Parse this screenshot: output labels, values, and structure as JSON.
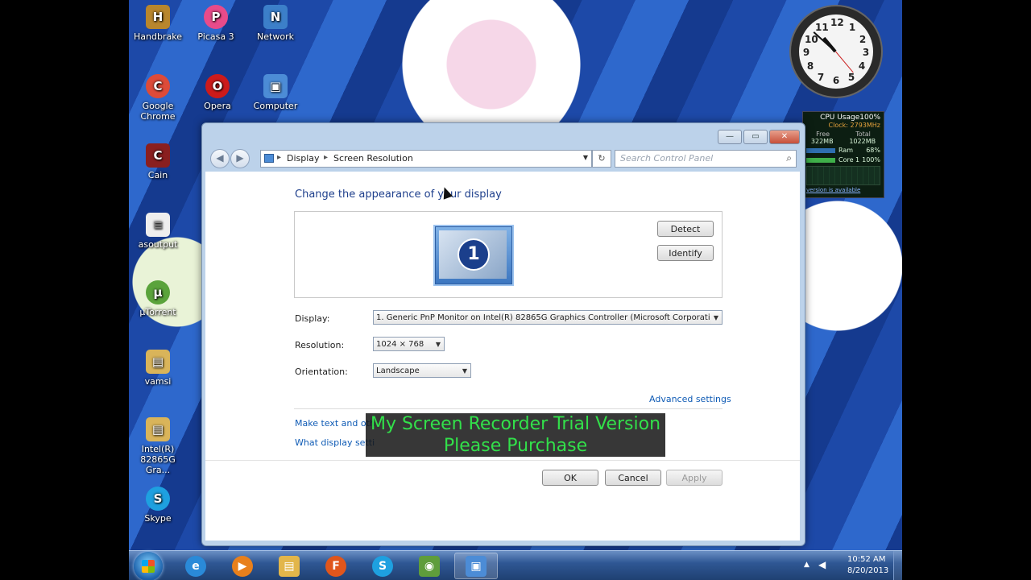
{
  "desktop": {
    "icons": [
      {
        "label": "Handbrake",
        "icon": "handbrake-icon",
        "color": "#b8862d",
        "glyph": "H"
      },
      {
        "label": "Picasa 3",
        "icon": "picasa-icon",
        "color": "#e84b8a",
        "glyph": "P"
      },
      {
        "label": "Network",
        "icon": "network-icon",
        "color": "#3c7fc9",
        "glyph": "N"
      },
      {
        "label": "Google Chrome",
        "icon": "chrome-icon",
        "color": "#dd4b39",
        "glyph": "C"
      },
      {
        "label": "Opera",
        "icon": "opera-icon",
        "color": "#cc1b1b",
        "glyph": "O"
      },
      {
        "label": "Computer",
        "icon": "computer-icon",
        "color": "#4c8cd6",
        "glyph": "▣"
      },
      {
        "label": "Cain",
        "icon": "cain-icon",
        "color": "#8a1f1f",
        "glyph": "C"
      },
      {
        "label": "asoutput",
        "icon": "document-icon",
        "color": "#eeeeee",
        "glyph": "≡"
      },
      {
        "label": "µTorrent",
        "icon": "utorrent-icon",
        "color": "#5aa33b",
        "glyph": "µ"
      },
      {
        "label": "vamsi",
        "icon": "folder-icon",
        "color": "#d9b45a",
        "glyph": "▤"
      },
      {
        "label": "Intel(R) 82865G Gra...",
        "icon": "intel-folder-icon",
        "color": "#d9b45a",
        "glyph": "▤"
      },
      {
        "label": "Skype",
        "icon": "skype-icon",
        "color": "#1ea0e0",
        "glyph": "S"
      }
    ]
  },
  "clock": {
    "numbers": [
      "12",
      "1",
      "2",
      "3",
      "4",
      "5",
      "6",
      "7",
      "8",
      "9",
      "10",
      "11"
    ]
  },
  "cpu_gadget": {
    "title": "CPU Usage100%",
    "clock": "Clock: 2793MHz",
    "ram_free": "322MB",
    "ram_total": "1022MB",
    "ram_label": "Ram",
    "ram_pct": "68%",
    "core_label": "Core 1",
    "core_pct": "100%",
    "free_label": "Free",
    "total_label": "Total",
    "footer": "version is available"
  },
  "window": {
    "controls": {
      "minimize": "—",
      "maximize": "▭",
      "close": "✕"
    },
    "back": "◀",
    "forward": "▶",
    "breadcrumb": {
      "root": "Display",
      "separator": "▸",
      "current": "Screen Resolution"
    },
    "refresh": "↻",
    "search_placeholder": "Search Control Panel",
    "heading": "Change the appearance of your display",
    "monitor_number": "1",
    "detect_label": "Detect",
    "identify_label": "Identify",
    "display_label": "Display:",
    "display_value": "1. Generic PnP Monitor on Intel(R) 82865G Graphics Controller (Microsoft Corporati",
    "resolution_label": "Resolution:",
    "resolution_value": "1024 × 768",
    "orientation_label": "Orientation:",
    "orientation_value": "Landscape",
    "advanced_link": "Advanced settings",
    "link1": "Make text and oth",
    "link2": "What display setti",
    "ok_label": "OK",
    "cancel_label": "Cancel",
    "apply_label": "Apply"
  },
  "watermark": {
    "line1": "My Screen Recorder Trial Version",
    "line2": "Please Purchase"
  },
  "taskbar": {
    "items": [
      {
        "icon": "internet-explorer-icon",
        "color": "#2a8ad8",
        "glyph": "e"
      },
      {
        "icon": "media-player-icon",
        "color": "#e8801c",
        "glyph": "▶"
      },
      {
        "icon": "explorer-folder-icon",
        "color": "#e2b64a",
        "glyph": "▤"
      },
      {
        "icon": "firefox-icon",
        "color": "#e0561c",
        "glyph": "F"
      },
      {
        "icon": "skype-icon",
        "color": "#1ea0e0",
        "glyph": "S"
      },
      {
        "icon": "screen-recorder-icon",
        "color": "#5f9d3b",
        "glyph": "◉"
      },
      {
        "icon": "control-panel-icon",
        "color": "#4c8cd6",
        "glyph": "▣"
      }
    ],
    "time": "10:52 AM",
    "date": "8/20/2013"
  }
}
